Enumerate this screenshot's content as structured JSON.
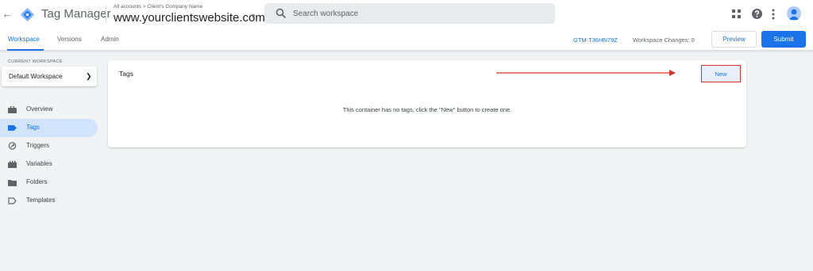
{
  "header": {
    "brand": "Tag Manager",
    "breadcrumb": "All accounts > Client's Company Name",
    "container_name": "www.yourclientswebsite.com",
    "search_placeholder": "Search workspace"
  },
  "nav": {
    "tabs": [
      {
        "label": "Workspace",
        "active": true
      },
      {
        "label": "Versions",
        "active": false
      },
      {
        "label": "Admin",
        "active": false
      }
    ],
    "container_id": "GTM-T36HN79Z",
    "workspace_changes": "Workspace Changes: 0",
    "preview_label": "Preview",
    "submit_label": "Submit"
  },
  "sidebar": {
    "workspace_label": "CURRENT WORKSPACE",
    "workspace_name": "Default Workspace",
    "items": [
      {
        "label": "Overview",
        "icon": "briefcase-icon",
        "active": false
      },
      {
        "label": "Tags",
        "icon": "tag-icon",
        "active": true
      },
      {
        "label": "Triggers",
        "icon": "trigger-icon",
        "active": false
      },
      {
        "label": "Variables",
        "icon": "variables-icon",
        "active": false
      },
      {
        "label": "Folders",
        "icon": "folder-icon",
        "active": false
      },
      {
        "label": "Templates",
        "icon": "template-icon",
        "active": false
      }
    ]
  },
  "main": {
    "card_title": "Tags",
    "empty_message": "This container has no tags, click the \"New\" button to create one.",
    "new_label": "New"
  },
  "colors": {
    "accent": "#1a73e8",
    "annotation": "#d93025",
    "active_nav_bg": "#d2e3fc",
    "page_bg": "#f1f3f4"
  }
}
